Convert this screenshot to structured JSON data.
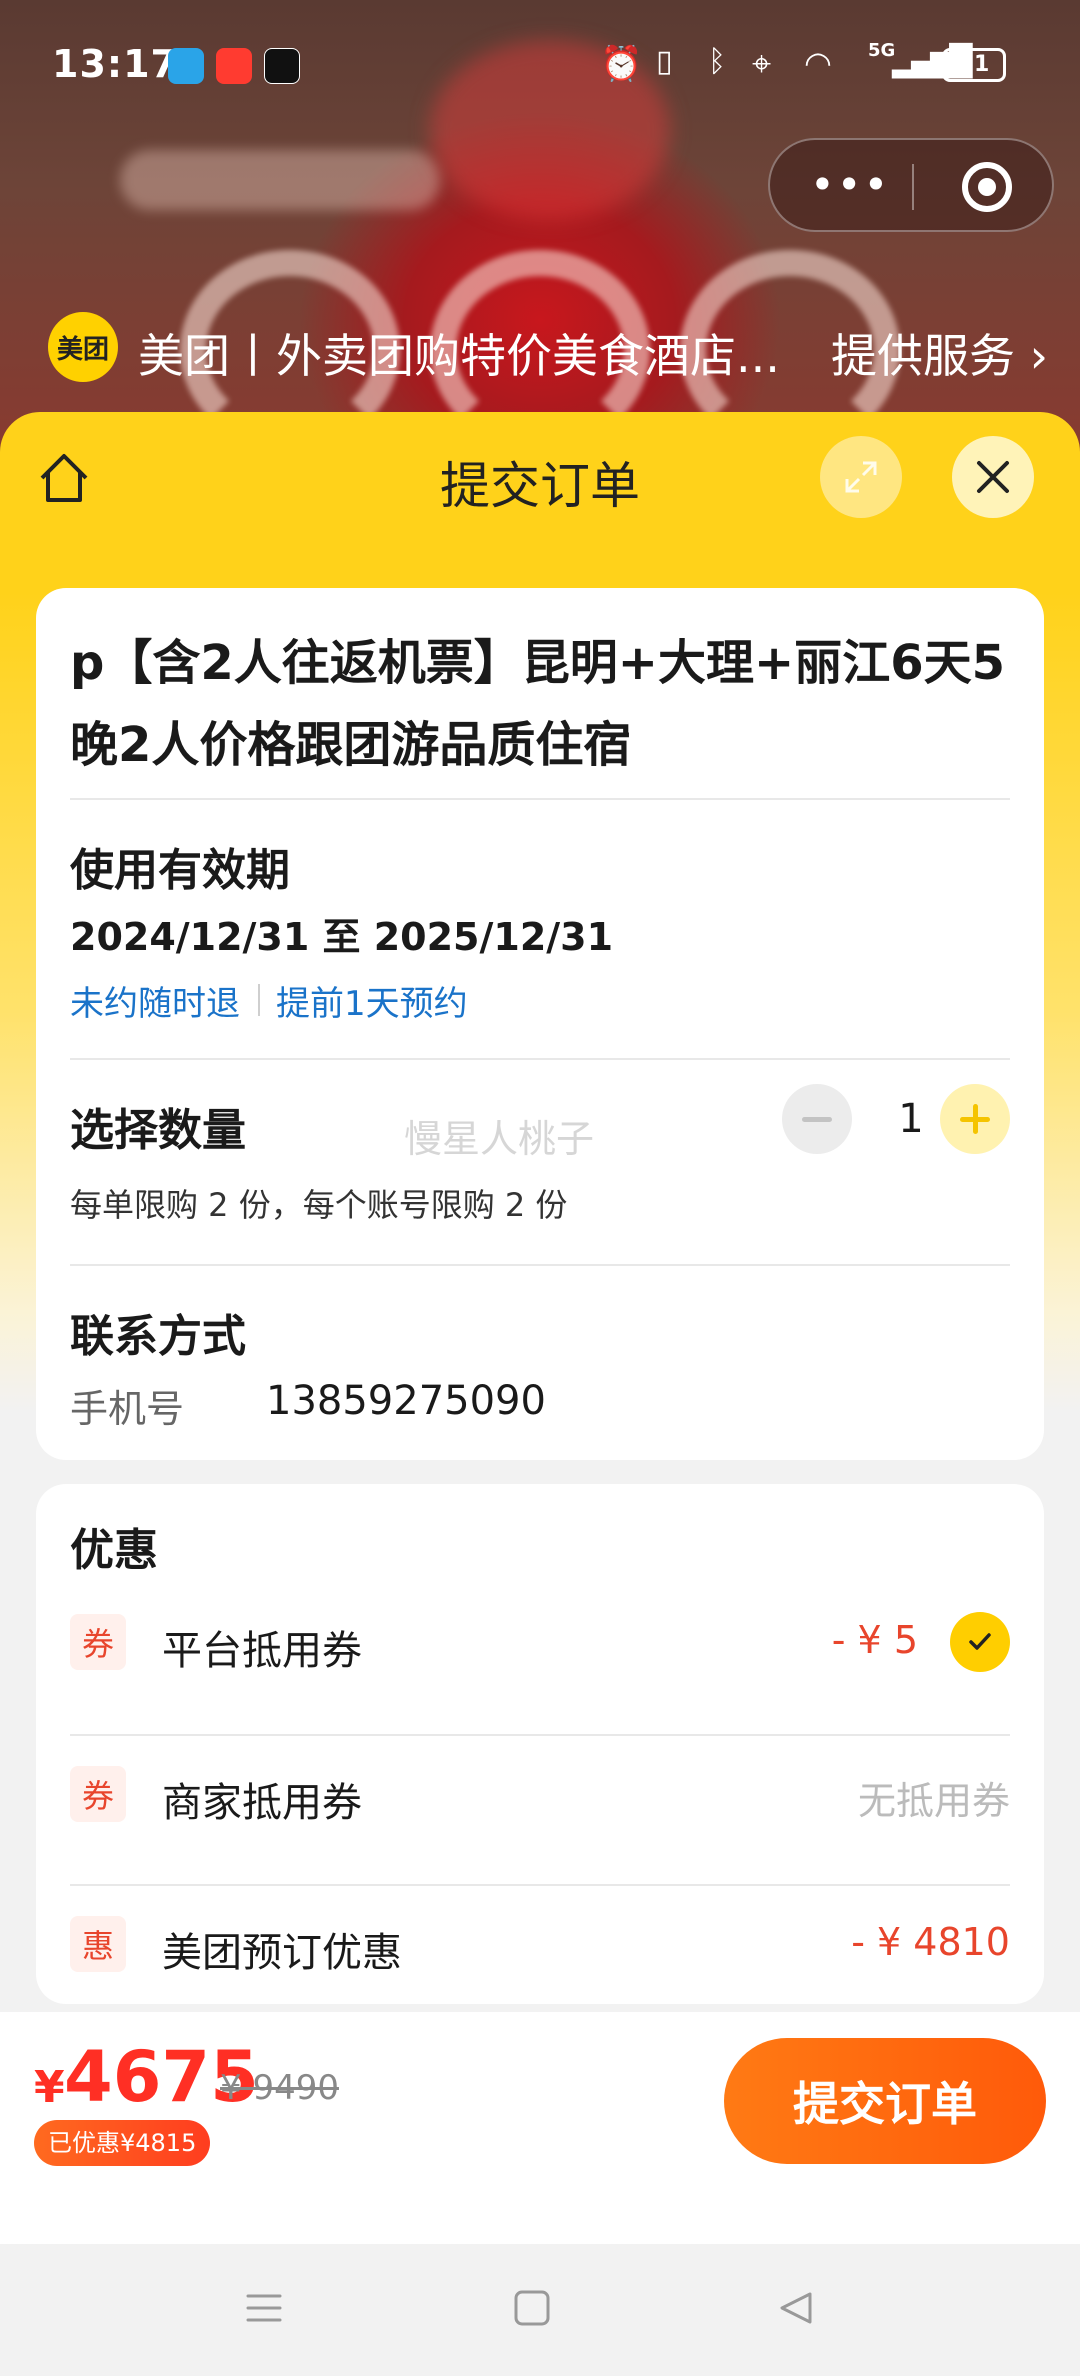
{
  "status_bar": {
    "time": "13:17",
    "battery": "51",
    "network": "5G"
  },
  "merchant": {
    "logo_text": "美团",
    "name": "美团丨外卖团购特价美食酒店...",
    "service_link": "提供服务"
  },
  "panel": {
    "title": "提交订单"
  },
  "product": {
    "title": "p【含2人往返机票】昆明+大理+丽江6天5晚2人价格跟团游品质住宿"
  },
  "validity": {
    "heading": "使用有效期",
    "dates": "2024/12/31 至 2025/12/31",
    "tag1": "未约随时退",
    "tag2": "提前1天预约"
  },
  "quantity": {
    "heading": "选择数量",
    "value": "1",
    "limit_note": "每单限购 2 份，每个账号限购 2 份",
    "watermark": "慢星人桃子"
  },
  "contact": {
    "heading": "联系方式",
    "phone_label": "手机号",
    "phone_value": "13859275090"
  },
  "discounts": {
    "heading": "优惠",
    "items": [
      {
        "badge": "券",
        "label": "平台抵用券",
        "value": "- ¥ 5",
        "selected": true
      },
      {
        "badge": "券",
        "label": "商家抵用券",
        "value": "无抵用券"
      },
      {
        "badge": "惠",
        "label": "美团预订优惠",
        "value": "- ¥ 4810"
      }
    ]
  },
  "checkout": {
    "currency": "¥",
    "price": "4675",
    "original_price": "¥ 9490",
    "saved": "已优惠¥4815",
    "submit_label": "提交订单"
  },
  "colors": {
    "brand_yellow": "#ffd21a",
    "price_red": "#ff2f24",
    "submit_orange": "#ff6a10",
    "link_blue": "#1a73c9"
  }
}
